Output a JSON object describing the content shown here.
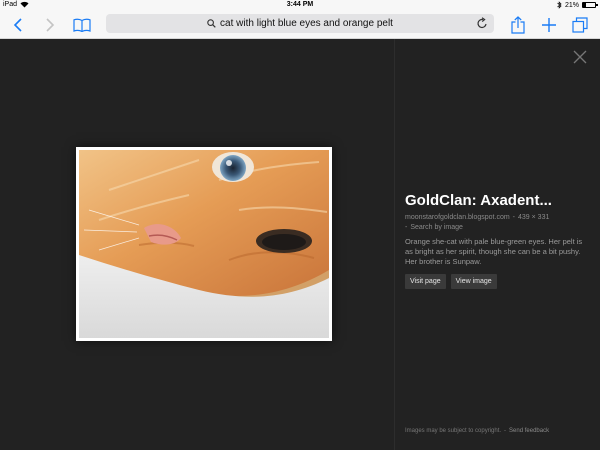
{
  "status_bar": {
    "device": "iPad",
    "time": "3:44 PM",
    "battery": "21%",
    "battery_level": 0.21
  },
  "toolbar": {
    "query": "cat with light blue eyes and orange pelt",
    "accent": "#1a7cf5",
    "icons": [
      "back-icon",
      "forward-icon",
      "bookmarks-icon",
      "search-icon",
      "reload-icon",
      "share-icon",
      "new-tab-icon",
      "tabs-icon"
    ]
  },
  "result": {
    "title": "GoldClan: Axadent...",
    "source": "moonstarofgoldclan.blogspot.com",
    "dimensions": "439 × 331",
    "search_by_image": "Search by image",
    "description": "Orange she-cat with pale blue-green eyes. Her pelt is as bright as her spirit, though she can be a bit pushy. Her brother is Sunpaw.",
    "visit_label": "Visit page",
    "view_label": "View image"
  },
  "footer": {
    "copyright": "Images may be subject to copyright.",
    "feedback": "Send feedback"
  }
}
